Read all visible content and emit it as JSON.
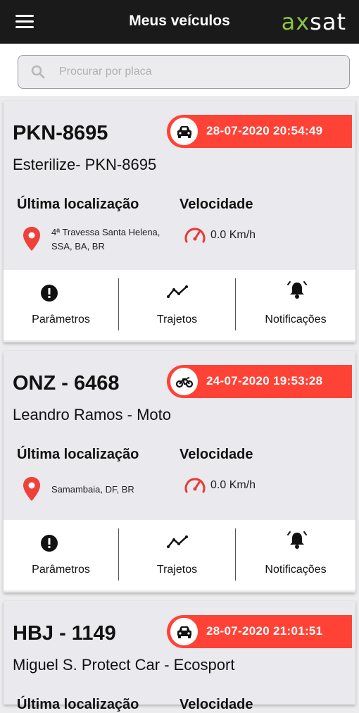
{
  "header": {
    "title": "Meus veículos",
    "brand_part1": "ax",
    "brand_part2": "sat",
    "menu_icon": "hamburger-icon"
  },
  "search": {
    "placeholder": "Procurar por placa",
    "value": ""
  },
  "labels": {
    "location": "Última localização",
    "speed": "Velocidade"
  },
  "actions": {
    "params": "Parâmetros",
    "routes": "Trajetos",
    "notifications": "Notificações"
  },
  "colors": {
    "accent": "#ff4236",
    "brand_green": "#8cc63f",
    "header_bg": "#1a1a1a"
  },
  "vehicles": [
    {
      "plate": "PKN-8695",
      "name": "Esterilize- PKN-8695",
      "type": "car",
      "datetime": "28-07-2020 20:54:49",
      "address_line1": "4ª Travessa Santa Helena,",
      "address_line2": "SSA, BA, BR",
      "speed": "0.0 Km/h"
    },
    {
      "plate": "ONZ - 6468",
      "name": "Leandro Ramos - Moto",
      "type": "motorcycle",
      "datetime": "24-07-2020 19:53:28",
      "address_line1": "Samambaia, DF, BR",
      "address_line2": "",
      "speed": "0.0 Km/h"
    },
    {
      "plate": "HBJ - 1149",
      "name": "Miguel S. Protect Car - Ecosport",
      "type": "car",
      "datetime": "28-07-2020 21:01:51"
    }
  ]
}
